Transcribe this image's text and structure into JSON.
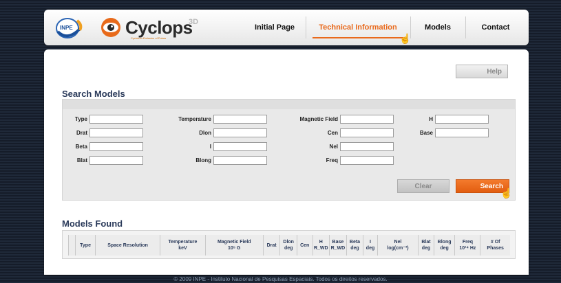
{
  "nav": {
    "items": [
      {
        "label": "Initial Page"
      },
      {
        "label": "Technical Information"
      },
      {
        "label": "Models"
      },
      {
        "label": "Contact"
      }
    ],
    "active_index": 1
  },
  "logos": {
    "inpe_text": "INPE",
    "cyclops_word": "Cyclops",
    "cyclops_superscript": "3D",
    "cyclops_tagline": "Cyclotron Emission of Polars"
  },
  "help_label": "Help",
  "search": {
    "title": "Search Models",
    "fields": [
      {
        "label": "Type",
        "value": ""
      },
      {
        "label": "Drat",
        "value": ""
      },
      {
        "label": "Beta",
        "value": ""
      },
      {
        "label": "Blat",
        "value": ""
      },
      {
        "label": "Temperature",
        "value": ""
      },
      {
        "label": "Dlon",
        "value": ""
      },
      {
        "label": "I",
        "value": ""
      },
      {
        "label": "Blong",
        "value": ""
      },
      {
        "label": "Magnetic Field",
        "value": ""
      },
      {
        "label": "Cen",
        "value": ""
      },
      {
        "label": "Nel",
        "value": ""
      },
      {
        "label": "Freq",
        "value": ""
      },
      {
        "label": "H",
        "value": ""
      },
      {
        "label": "Base",
        "value": ""
      }
    ],
    "clear_label": "Clear",
    "search_label": "Search"
  },
  "results": {
    "title": "Models Found",
    "columns": [
      {
        "line1": "Type",
        "line2": ""
      },
      {
        "line1": "Space Resolution",
        "line2": ""
      },
      {
        "line1": "Temperature",
        "line2": "keV"
      },
      {
        "line1": "Magnetic Field",
        "line2": "10⁵ G"
      },
      {
        "line1": "Drat",
        "line2": ""
      },
      {
        "line1": "Dlon",
        "line2": "deg"
      },
      {
        "line1": "Cen",
        "line2": ""
      },
      {
        "line1": "H",
        "line2": "R_WD"
      },
      {
        "line1": "Base",
        "line2": "R_WD"
      },
      {
        "line1": "Beta",
        "line2": "deg"
      },
      {
        "line1": "I",
        "line2": "deg"
      },
      {
        "line1": "Nel",
        "line2": "log(cm⁻³)"
      },
      {
        "line1": "Blat",
        "line2": "deg"
      },
      {
        "line1": "Blong",
        "line2": "deg"
      },
      {
        "line1": "Freq",
        "line2": "10¹⁴ Hz"
      },
      {
        "line1": "# Of",
        "line2": "Phases"
      }
    ]
  },
  "footer_text": "© 2009 INPE - Instituto Nacional de Pesquisas Espaciais. Todos os direitos reservados."
}
